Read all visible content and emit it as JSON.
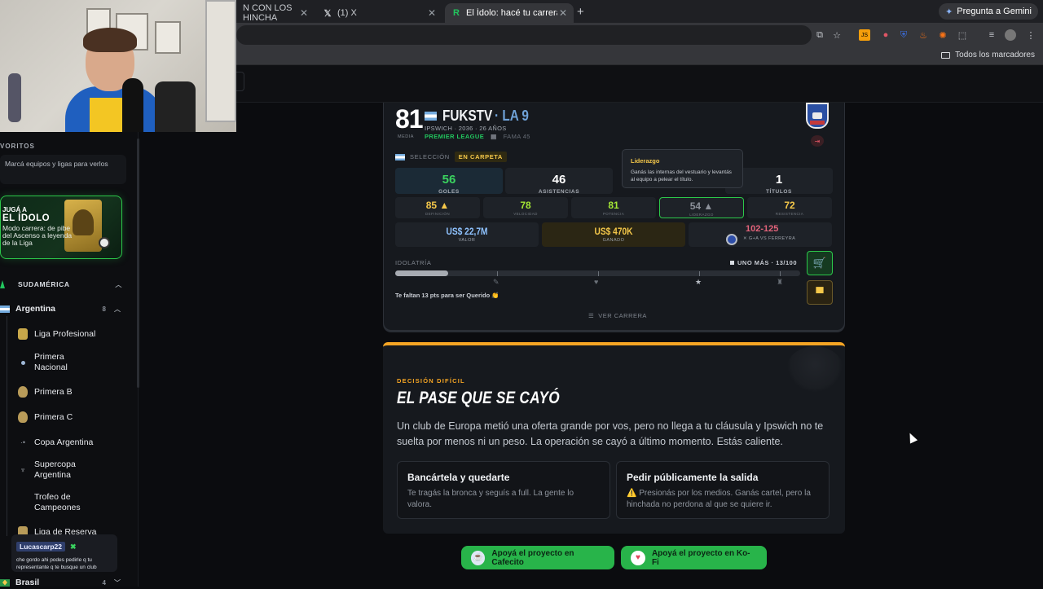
{
  "browser": {
    "tabs": [
      {
        "label": "N CON LOS HINCHA",
        "active": false
      },
      {
        "label": "(1) X",
        "active": false
      },
      {
        "label": "El Ídolo: hacé tu carrera en la",
        "active": true
      }
    ],
    "gemini": "Pregunta a Gemini",
    "all_bookmarks": "Todos los marcadores"
  },
  "sidebar": {
    "favorites_title": "VORITOS",
    "favorites_hint": "Marcá equipos y ligas para verlos",
    "promo": {
      "small": "JUGÁ A",
      "title": "EL ÍDOLO",
      "desc": "Modo carrera: de pibe del Ascenso a leyenda de la Liga"
    },
    "region": "SUDAMÉRICA",
    "countries": [
      {
        "name": "Argentina",
        "count": "8"
      },
      {
        "name": "Brasil",
        "count": "4"
      }
    ],
    "leagues": [
      {
        "name": "Liga Profesional"
      },
      {
        "name": "Primera Nacional"
      },
      {
        "name": "Primera B"
      },
      {
        "name": "Primera C"
      },
      {
        "name": "Copa Argentina"
      },
      {
        "name": "Supercopa Argentina"
      },
      {
        "name": "Trofeo de Campeones"
      },
      {
        "name": "Liga de Reserva"
      }
    ]
  },
  "chat": {
    "user": "Lucascarp22",
    "message": "che gordo ahi podes pedirle q tu representante q te busque un club"
  },
  "player": {
    "overall": "81",
    "overall_label": "MEDIA",
    "name": "FUKSTV",
    "nickname": "· LA 9",
    "meta": "IPSWICH · 2036 · 26 AÑOS",
    "league": "PREMIER LEAGUE",
    "fame": "FAMA 45",
    "selection_label": "SELECCIÓN",
    "selection_status": "EN CARPETA",
    "stats": [
      {
        "value": "56",
        "label": "GOLES"
      },
      {
        "value": "46",
        "label": "ASISTENCIAS"
      },
      {
        "value": "1",
        "label": "TÍTULOS"
      }
    ],
    "attributes": [
      {
        "value": "85 ▲",
        "label": "DEFINICIÓN"
      },
      {
        "value": "78",
        "label": "VELOCIDAD"
      },
      {
        "value": "81",
        "label": "POTENCIA"
      },
      {
        "value": "54 ▲",
        "label": "LIDERAZGO"
      },
      {
        "value": "72",
        "label": "RESISTENCIA"
      }
    ],
    "value": {
      "amount": "US$ 22,7M",
      "label": "VALOR"
    },
    "earned": {
      "amount": "US$ 470K",
      "label": "GANADO"
    },
    "rival": {
      "score": "102-125",
      "label": "✕ G+A VS FERREYRA"
    },
    "tooltip": {
      "title": "Liderazgo",
      "text": "Ganás las internas del vestuario y levantás al equipo a pelear el título."
    },
    "idol": {
      "label": "IDOLATRÍA",
      "status": "UNO MÁS · 13/100",
      "progress": 0.13,
      "note": "Te faltan 13 pts para ser Querido 👏"
    },
    "career_link": "VER CARRERA"
  },
  "decision": {
    "kicker": "DECISIÓN DIFÍCIL",
    "title": "EL PASE QUE SE CAYÓ",
    "text": "Un club de Europa metió una oferta grande por vos, pero no llega a tu cláusula y Ipswich no te suelta por menos ni un peso. La operación se cayó a último momento. Estás caliente.",
    "options": [
      {
        "title": "Bancártela y quedarte",
        "text": "Te tragás la bronca y seguís a full. La gente lo valora."
      },
      {
        "title": "Pedir públicamente la salida",
        "text": "⚠️ Presionás por los medios. Ganás cartel, pero la hinchada no perdona al que se quiere ir."
      }
    ]
  },
  "support": {
    "cafecito": "Apoyá el proyecto en Cafecito",
    "kofi": "Apoyá el proyecto en Ko-Fi"
  },
  "colors": {
    "accent_green": "#22c55e",
    "accent_orange": "#f5a524",
    "goals_green": "#3ad35f",
    "assists_white": "#ffffff",
    "value_blue": "#8fc3ff",
    "earned_gold": "#f5c84a",
    "rival_red": "#e2637a"
  }
}
